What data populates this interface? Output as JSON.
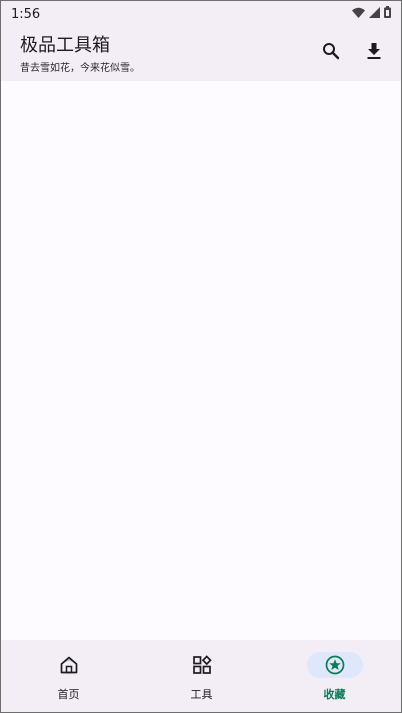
{
  "status_bar": {
    "time": "1:56",
    "icons": [
      "wifi-icon",
      "signal-icon",
      "battery-icon"
    ]
  },
  "app_bar": {
    "title": "极品工具箱",
    "subtitle": "昔去雪如花，今来花似雪。",
    "actions": [
      "search-icon",
      "download-icon"
    ]
  },
  "bottom_nav": {
    "items": [
      {
        "label": "首页",
        "icon": "home-icon",
        "selected": false
      },
      {
        "label": "工具",
        "icon": "grid-icon",
        "selected": false
      },
      {
        "label": "收藏",
        "icon": "star-icon",
        "selected": true
      }
    ]
  },
  "colors": {
    "bar_background": "#f3eef6",
    "content_background": "#fdfbff",
    "active_indicator": "#dfe7fb",
    "active_accent": "#0f7a57"
  }
}
